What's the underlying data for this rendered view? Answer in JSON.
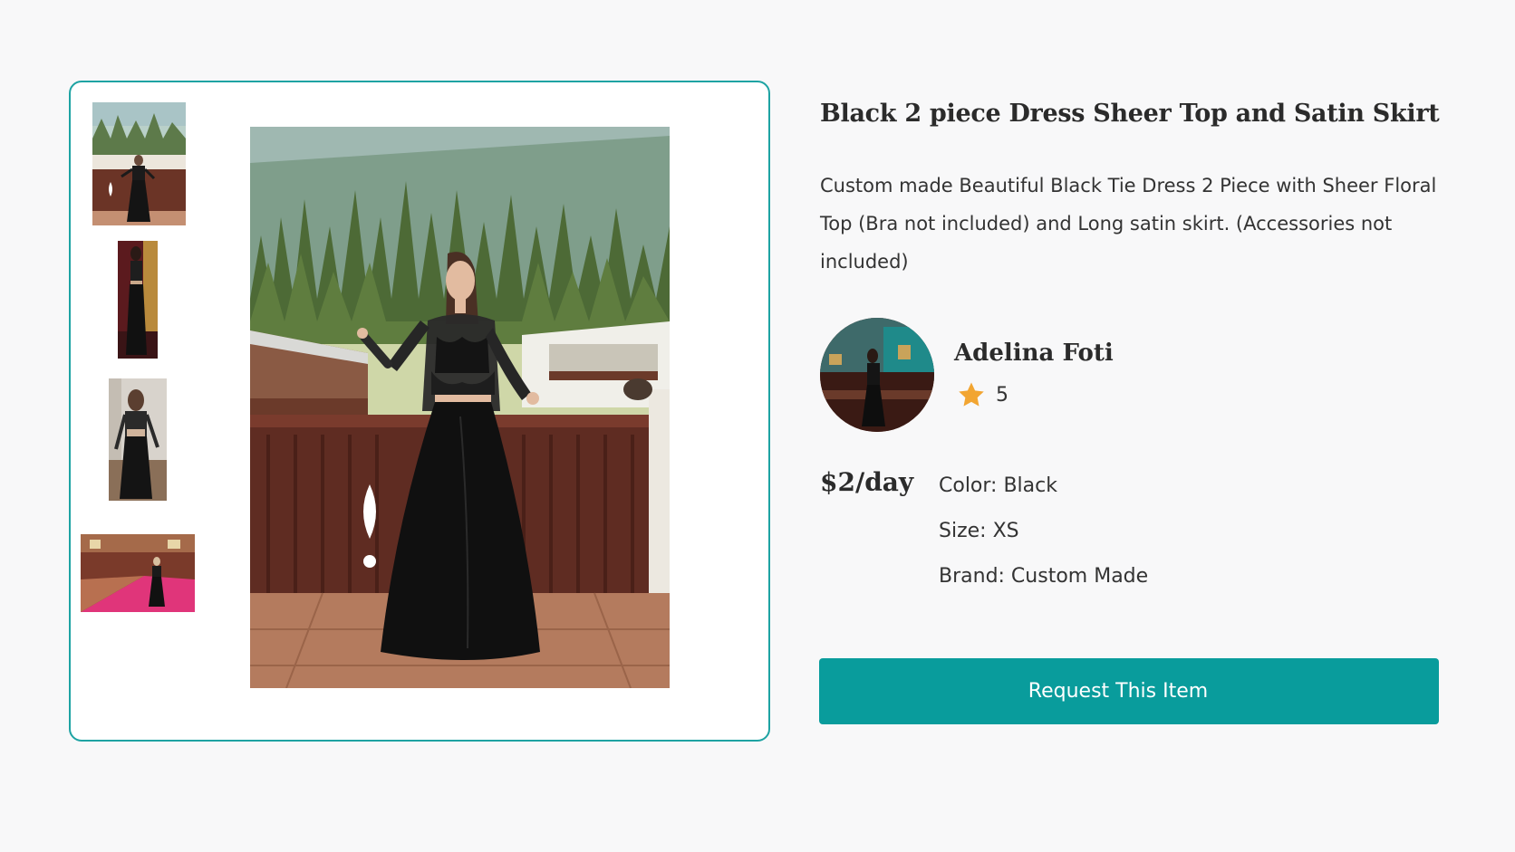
{
  "gallery": {
    "thumbnails": [
      {
        "name": "thumbnail-1"
      },
      {
        "name": "thumbnail-2"
      },
      {
        "name": "thumbnail-3"
      },
      {
        "name": "thumbnail-4"
      }
    ],
    "accent_color": "#1ea3a3"
  },
  "product": {
    "title": "Black 2 piece Dress Sheer Top and Satin Skirt",
    "description": "Custom made Beautiful Black Tie Dress 2 Piece with Sheer Floral Top (Bra not included) and Long satin skirt. (Accessories not included)",
    "price": "$2/day",
    "attributes": {
      "color": "Color: Black",
      "size": "Size: XS",
      "brand": "Brand: Custom Made"
    }
  },
  "seller": {
    "name": "Adelina Foti",
    "rating": "5",
    "star_color": "#f2a531"
  },
  "actions": {
    "request_label": "Request This Item",
    "button_color": "#099c9c"
  }
}
